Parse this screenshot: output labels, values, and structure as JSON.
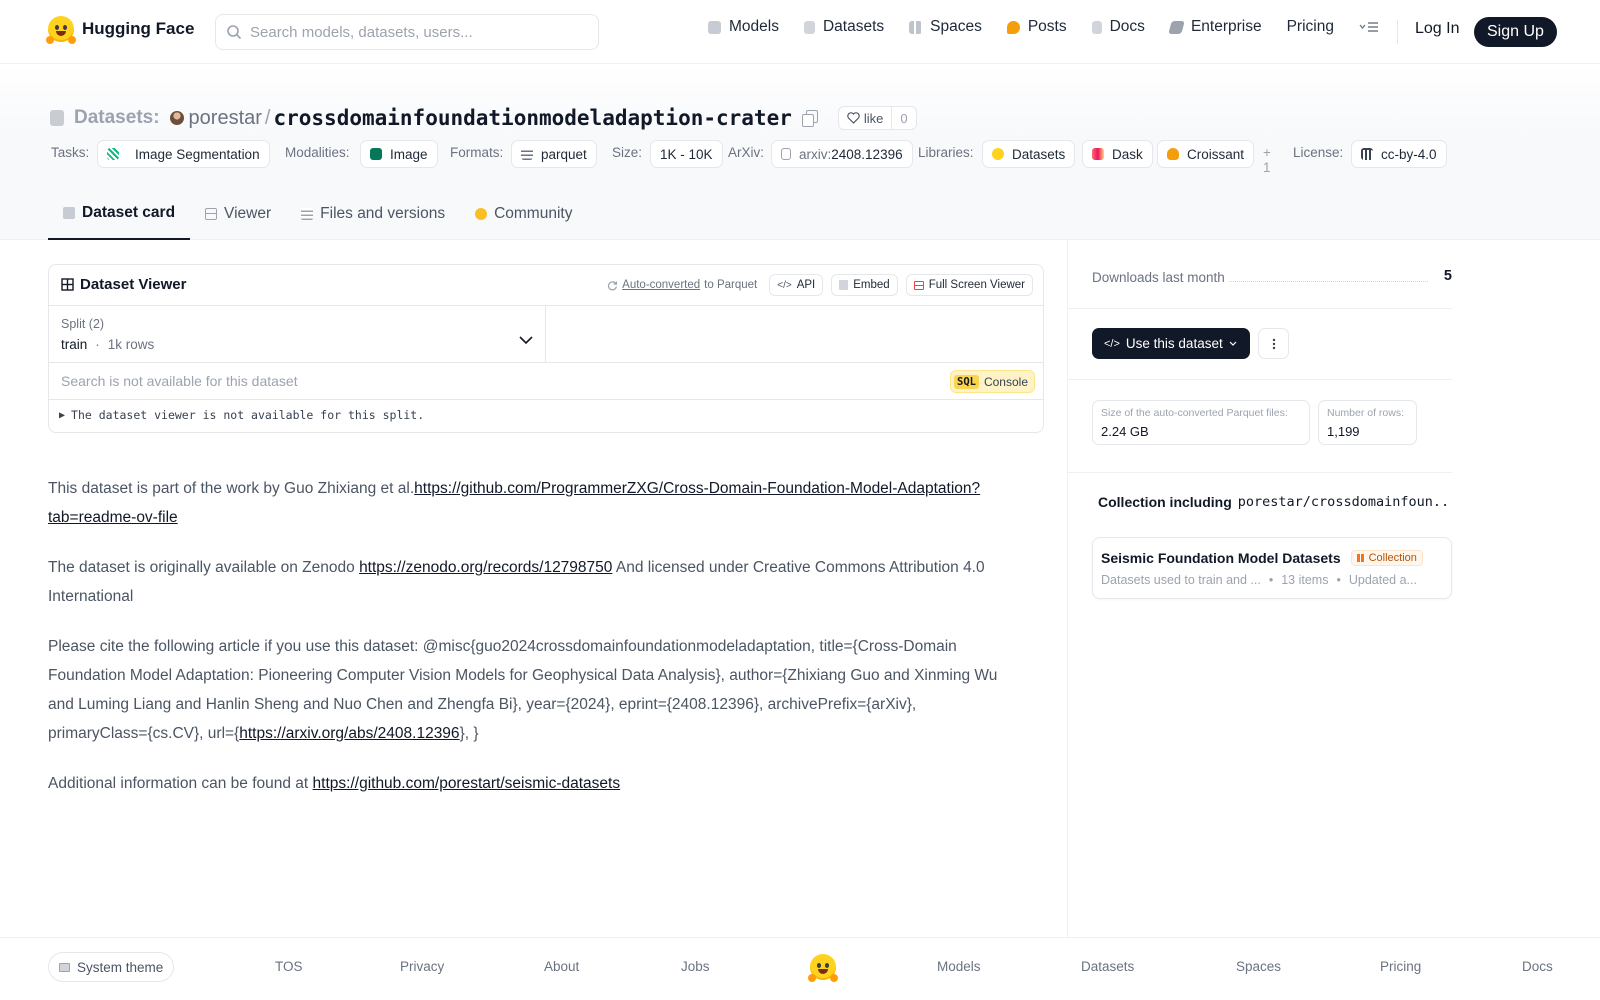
{
  "nav": {
    "brand": "Hugging Face",
    "search_placeholder": "Search models, datasets, users...",
    "links": [
      "Models",
      "Datasets",
      "Spaces",
      "Posts",
      "Docs",
      "Enterprise",
      "Pricing"
    ],
    "login": "Log In",
    "signup": "Sign Up"
  },
  "header": {
    "type_label": "Datasets:",
    "owner": "porestar",
    "slash": "/",
    "name": "crossdomainfoundationmodeladaption-crater",
    "like_label": "like",
    "like_count": "0",
    "labels": {
      "tasks": "Tasks:",
      "modalities": "Modalities:",
      "formats": "Formats:",
      "size": "Size:",
      "arxiv": "ArXiv:",
      "libraries": "Libraries:",
      "license": "License:"
    },
    "task": "Image Segmentation",
    "modality": "Image",
    "format": "parquet",
    "size": "1K - 10K",
    "arxiv_prefix": "arxiv:",
    "arxiv_id": "2408.12396",
    "libraries": [
      "Datasets",
      "Dask",
      "Croissant"
    ],
    "libraries_more": "+ 1",
    "license": "cc-by-4.0"
  },
  "tabs": [
    "Dataset card",
    "Viewer",
    "Files and versions",
    "Community"
  ],
  "viewer": {
    "title": "Dataset Viewer",
    "auto_converted": "Auto-converted",
    "to_parquet": "to Parquet",
    "api": "API",
    "embed": "Embed",
    "fullscreen": "Full Screen Viewer",
    "split_label": "Split (2)",
    "split_name": "train",
    "split_dot": "·",
    "split_rows": "1k rows",
    "search_placeholder": "Search is not available for this dataset",
    "sql_tag": "SQL",
    "sql_label": "Console",
    "note": "The dataset viewer is not available for this split."
  },
  "card": {
    "p1_text": "This dataset is part of the work by Guo Zhixiang et al.",
    "p1_link": "https://github.com/ProgrammerZXG/Cross-Domain-Foundation-Model-Adaptation?tab=readme-ov-file",
    "p2_text": "The dataset is originally available on Zenodo ",
    "p2_link": "https://zenodo.org/records/12798750",
    "p2_tail": " And licensed under Creative Commons Attribution 4.0 International",
    "p3_text": "Please cite the following article if you use this dataset: @misc{guo2024crossdomainfoundationmodeladaptation, title={Cross-Domain Foundation Model Adaptation: Pioneering Computer Vision Models for Geophysical Data Analysis}, author={Zhixiang Guo and Xinming Wu and Luming Liang and Hanlin Sheng and Nuo Chen and Zhengfa Bi}, year={2024}, eprint={2408.12396}, archivePrefix={arXiv}, primaryClass={cs.CV}, url={",
    "p3_link": "https://arxiv.org/abs/2408.12396",
    "p3_tail": "}, }",
    "p4_text": "Additional information can be found at ",
    "p4_link": "https://github.com/porestart/seismic-datasets"
  },
  "sidebar": {
    "downloads_label": "Downloads last month",
    "downloads_value": "5",
    "use_button": "Use this dataset",
    "parquet_size_label": "Size of the auto-converted Parquet files:",
    "parquet_size_value": "2.24 GB",
    "rows_label": "Number of rows:",
    "rows_value": "1,199",
    "collection_heading": "Collection including",
    "collection_repo": "porestar/crossdomainfoun...",
    "collection_name": "Seismic Foundation Model Datasets",
    "collection_badge": "Collection",
    "collection_desc": "Datasets used to train and ...",
    "collection_items": "13 items",
    "collection_updated": "Updated a...",
    "meta_sep": "•"
  },
  "footer": {
    "theme": "System theme",
    "links": [
      "TOS",
      "Privacy",
      "About",
      "Jobs",
      "Models",
      "Datasets",
      "Spaces",
      "Pricing",
      "Docs"
    ]
  },
  "colors": {
    "brand_yellow": "#ffd21e",
    "dark_button": "#111827",
    "sql_badge": "#fcd34d"
  }
}
